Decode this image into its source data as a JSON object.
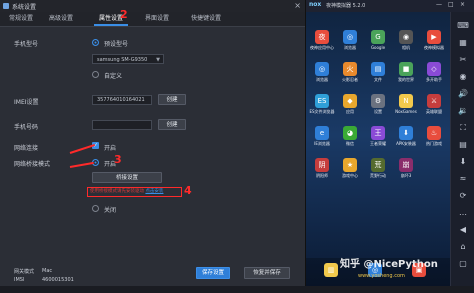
{
  "dialog": {
    "title": "系统设置",
    "close": "×",
    "tabs": [
      {
        "label": "常规设置"
      },
      {
        "label": "高级设置"
      },
      {
        "label": "属性设置"
      },
      {
        "label": "界面设置"
      },
      {
        "label": "快捷键设置"
      }
    ],
    "phone_model_label": "手机型号",
    "preset_model": "预设型号",
    "model_value": "samsung SM-G9350",
    "custom": "自定义",
    "imei_label": "IMEI设置",
    "imei_value": "357764010164021",
    "generate1": "创建",
    "phone_number_label": "手机号码",
    "phone_number_value": "",
    "generate2": "创建",
    "network_label": "网络连接",
    "network_checkbox": "开启",
    "bridge_label": "网络桥接模式",
    "bridge_on": "开启",
    "install_driver": "桥接设置",
    "warn_text": "使用桥接模式请先安装驱动",
    "warn_link": "点击安装",
    "bridge_off": "关闭",
    "footer_label1": "网关模式",
    "footer_value1": "Mac",
    "footer_label2": "IMSI",
    "footer_value2": "4600015301",
    "save": "保存设置",
    "restore": "恢复并保存"
  },
  "annotations": [
    "1",
    "2",
    "3",
    "4"
  ],
  "emulator": {
    "logo": "nox",
    "title": "夜神模拟器 5.2.0",
    "window_controls": [
      "—",
      "□",
      "×"
    ],
    "apps": [
      {
        "label": "夜神应用中心",
        "color": "#e84d3d",
        "glyph": "夜"
      },
      {
        "label": "浏览器",
        "color": "#2f7fd8",
        "glyph": "◎"
      },
      {
        "label": "Google",
        "color": "#4aa35a",
        "glyph": "G"
      },
      {
        "label": "相机",
        "color": "#555",
        "glyph": "◉"
      },
      {
        "label": "夜神模拟器",
        "color": "#e84d3d",
        "glyph": "▶"
      },
      {
        "label": "浏览器",
        "color": "#2f7fd8",
        "glyph": "◎"
      },
      {
        "label": "火影忍者",
        "color": "#e88a2d",
        "glyph": "火"
      },
      {
        "label": "文件",
        "color": "#2f7fd8",
        "glyph": "▤"
      },
      {
        "label": "我的世界",
        "color": "#4aa35a",
        "glyph": "■"
      },
      {
        "label": "多开助手",
        "color": "#8a4bd6",
        "glyph": "◇"
      },
      {
        "label": "ES文件浏览器",
        "color": "#2f9fd8",
        "glyph": "ES"
      },
      {
        "label": "应用",
        "color": "#e8a72d",
        "glyph": "◆"
      },
      {
        "label": "设置",
        "color": "#6b7280",
        "glyph": "⚙"
      },
      {
        "label": "NoxGames",
        "color": "#f2c94c",
        "glyph": "N"
      },
      {
        "label": "英雄联盟",
        "color": "#c63d3d",
        "glyph": "⚔"
      },
      {
        "label": "IE浏览器",
        "color": "#2f7fd8",
        "glyph": "e"
      },
      {
        "label": "微信",
        "color": "#3aaa35",
        "glyph": "◕"
      },
      {
        "label": "王者荣耀",
        "color": "#8a4bd6",
        "glyph": "王"
      },
      {
        "label": "APK安装器",
        "color": "#2f7fd8",
        "glyph": "⬇"
      },
      {
        "label": "热门游戏",
        "color": "#e84d3d",
        "glyph": "♨"
      },
      {
        "label": "阴阳师",
        "color": "#c63d3d",
        "glyph": "阴"
      },
      {
        "label": "游戏中心",
        "color": "#e8a72d",
        "glyph": "★"
      },
      {
        "label": "荒野行动",
        "color": "#556b2f",
        "glyph": "荒"
      },
      {
        "label": "崩坏3",
        "color": "#8a2d6b",
        "glyph": "崩"
      }
    ],
    "dock": [
      {
        "label": "文件",
        "color": "#f2c94c",
        "glyph": "▥"
      },
      {
        "label": "浏览器",
        "color": "#2f7fd8",
        "glyph": "◎"
      },
      {
        "label": "相册",
        "color": "#e84d3d",
        "glyph": "▣"
      }
    ],
    "sidebar_icons": [
      {
        "name": "keyboard-icon",
        "glyph": "⌨"
      },
      {
        "name": "multi-icon",
        "glyph": "▦"
      },
      {
        "name": "scissors-icon",
        "glyph": "✂"
      },
      {
        "name": "location-icon",
        "glyph": "◉"
      },
      {
        "name": "volume-up-icon",
        "glyph": "🔊"
      },
      {
        "name": "volume-down-icon",
        "glyph": "🔉"
      },
      {
        "name": "screenshot-icon",
        "glyph": "⛶"
      },
      {
        "name": "folder-icon",
        "glyph": "▤"
      },
      {
        "name": "apk-icon",
        "glyph": "⬇"
      },
      {
        "name": "shake-icon",
        "glyph": "≈"
      },
      {
        "name": "rotate-icon",
        "glyph": "⟳"
      },
      {
        "name": "more-icon",
        "glyph": "…"
      },
      {
        "name": "back-icon",
        "glyph": "◀"
      },
      {
        "name": "home-icon",
        "glyph": "⌂"
      },
      {
        "name": "recent-icon",
        "glyph": "▢"
      }
    ]
  },
  "watermark": {
    "text": "知乎 @NicePython",
    "sub": "www.yosheng.com"
  }
}
